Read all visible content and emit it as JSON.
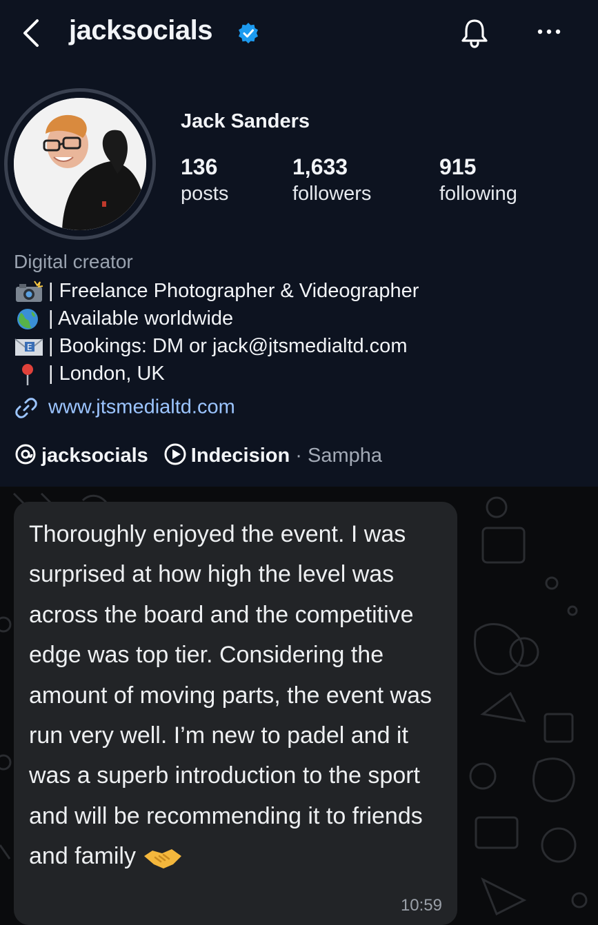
{
  "header": {
    "username": "jacksocials",
    "icons": [
      "back-icon",
      "verified-icon",
      "bell-icon",
      "more-icon"
    ],
    "accent_color": "#1d9bf0"
  },
  "profile": {
    "full_name": "Jack Sanders",
    "stats": [
      {
        "value": "136",
        "label": "posts"
      },
      {
        "value": "1,633",
        "label": "followers"
      },
      {
        "value": "915",
        "label": "following"
      }
    ],
    "category": "Digital creator",
    "bio": [
      {
        "icon": "camera-flash-icon",
        "text": "| Freelance Photographer & Videographer"
      },
      {
        "icon": "globe-icon",
        "text": "| Available worldwide"
      },
      {
        "icon": "envelope-icon",
        "text": "| Bookings: DM or jack@jtsmedialtd.com"
      },
      {
        "icon": "pin-icon",
        "text": "| London, UK"
      }
    ],
    "link": "www.jtsmedialtd.com",
    "threads_handle": "jacksocials",
    "music": {
      "title": "Indecision",
      "separator": " · ",
      "artist": "Sampha"
    }
  },
  "chat": {
    "message": "Thoroughly enjoyed the event. I was surprised at how high the level was across the board and the competitive edge was top tier. Considering the amount of moving parts, the event was run very well. I’m new to padel and it was a superb introduction to the sport and will be recommending it to friends and family",
    "emoji": "handshake-icon",
    "time": "10:59",
    "bubble_color": "#222427"
  }
}
